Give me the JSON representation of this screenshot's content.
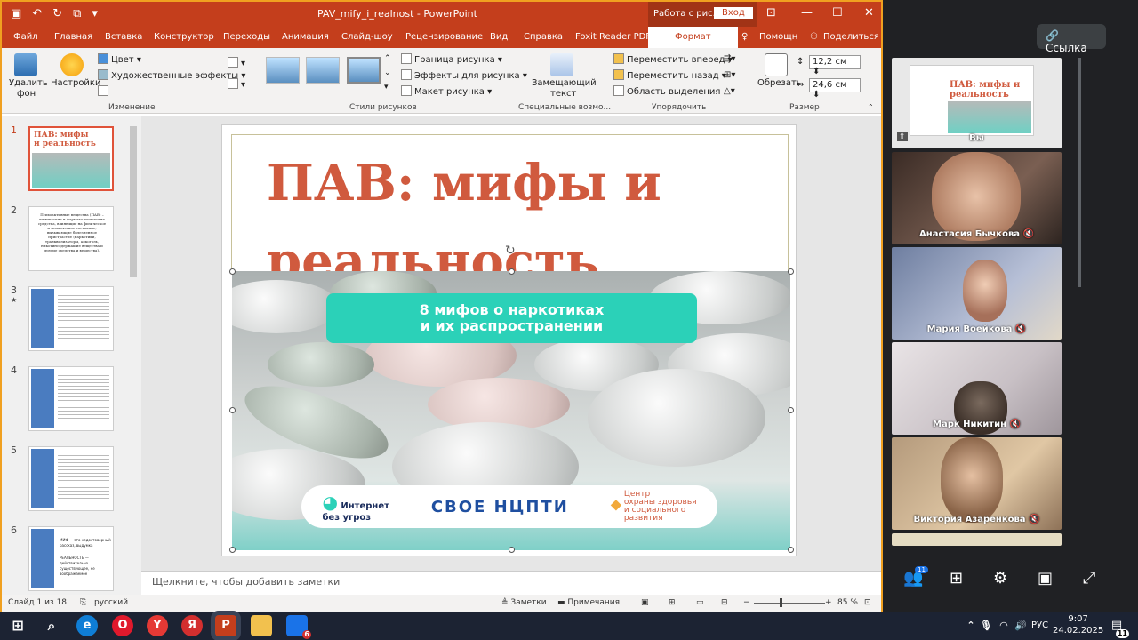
{
  "titlebar": {
    "document": "PAV_mify_i_realnost",
    "separator": " - ",
    "app": "PowerPoint",
    "context_tab": "Работа с рис...",
    "login": "Вход"
  },
  "tabs": [
    "Файл",
    "Главная",
    "Вставка",
    "Конструктор",
    "Переходы",
    "Анимация",
    "Слайд-шоу",
    "Рецензирование",
    "Вид",
    "Справка",
    "Foxit Reader PDF"
  ],
  "active_tab": "Формат",
  "tabs_right": {
    "help": "Помощн",
    "share": "Поделиться"
  },
  "ribbon": {
    "remove_bg": [
      "Удалить",
      "фон"
    ],
    "corrections": "Настройки",
    "color": "Цвет",
    "artistic": "Художественные эффекты",
    "group_change": "Изменение",
    "border": "Граница рисунка",
    "effects": "Эффекты для рисунка",
    "layout": "Макет рисунка",
    "group_styles": "Стили рисунков",
    "alt_text": [
      "Замещающий",
      "текст"
    ],
    "group_special": "Специальные возмо...",
    "forward": "Переместить вперед",
    "backward": "Переместить назад",
    "selection": "Область выделения",
    "group_arrange": "Упорядочить",
    "crop": "Обрезать",
    "height": "12,2 см",
    "width": "24,6 см",
    "group_size": "Размер"
  },
  "slides_panel": {
    "numbers": [
      "1",
      "2",
      "3",
      "4",
      "5",
      "6"
    ],
    "star": "★",
    "thumb1": "ПАВ: мифы и реальность",
    "thumb2": "Психоактивные вещества (ПАВ) – химические и фармакологические средства, влияющие на физическое и психическое состояние, вызывающие болезненное пристрастие (наркотики, транквилизаторы, алкоголь, никотинсодержащие вещества и другие средства и вещества).",
    "thumb6": [
      "МИФ — это недостоверный рассказ, выдумка",
      "РЕАЛЬНОСТЬ — действительно существующее, не воображаемое"
    ]
  },
  "slide": {
    "title": "ПАВ: мифы и реальность",
    "banner": [
      "8 мифов о наркотиках",
      "и их распространении"
    ],
    "logo1": [
      "Интернет",
      "без угроз"
    ],
    "logo2": "СВОЕ НЦПТИ",
    "logo3": [
      "Центр",
      "охраны здоровья",
      "и социального",
      "развития"
    ]
  },
  "notes_placeholder": "Щелкните, чтобы добавить заметки",
  "status": {
    "slide": "Слайд 1 из 18",
    "lang": "русский",
    "notes": "Заметки",
    "comments": "Примечания",
    "zoom": "85 %"
  },
  "meet": {
    "link": "Ссылка",
    "participants": [
      {
        "name": "Вы"
      },
      {
        "name": "Анастасия Бычкова"
      },
      {
        "name": "Мария Воейкова"
      },
      {
        "name": "Марк Никитин"
      },
      {
        "name": "Виктория Азаренкова"
      }
    ],
    "participant_count": "11"
  },
  "taskbar": {
    "lang": "РУС",
    "time": "9:07",
    "date": "24.02.2025",
    "notif": "11",
    "mail_badge": "6"
  },
  "colors": {
    "ppt_accent": "#c43e1c",
    "slide_title": "#d05a3e",
    "banner": "#2bd1b8",
    "meet_bg": "#202124"
  },
  "icons": [
    "save-icon",
    "undo-icon",
    "redo-icon",
    "search-icon",
    "edge-icon",
    "opera-icon",
    "yandex-browser-icon",
    "yandex-icon",
    "powerpoint-icon",
    "explorer-icon",
    "mail-icon",
    "people-icon",
    "grid-icon",
    "gear-icon",
    "layout-icon",
    "fullscreen-icon",
    "link-icon",
    "mic-off-icon"
  ]
}
